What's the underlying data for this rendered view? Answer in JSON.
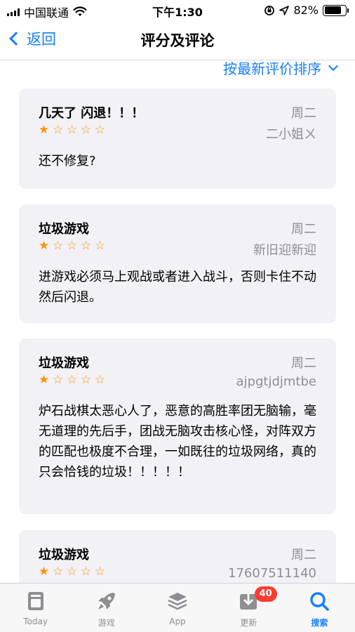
{
  "status_bar": {
    "carrier": "中国联通",
    "time": "下午1:30",
    "battery_percent_label": "82%",
    "battery_level": 0.82
  },
  "nav": {
    "back_label": "返回",
    "title": "评分及评论"
  },
  "sort": {
    "label": "按最新评价排序"
  },
  "reviews": [
    {
      "title": "几天了 闪退！！！",
      "date": "周二",
      "author": "二小姐ㄨ",
      "rating": 1,
      "stars": [
        "★",
        "☆",
        "☆",
        "☆",
        "☆"
      ],
      "body": "还不修复?"
    },
    {
      "title": "垃圾游戏",
      "date": "周二",
      "author": "新旧迎新迎",
      "rating": 1,
      "stars": [
        "★",
        "☆",
        "☆",
        "☆",
        "☆"
      ],
      "body": "进游戏必须马上观战或者进入战斗，否则卡住不动然后闪退。"
    },
    {
      "title": "垃圾游戏",
      "date": "周二",
      "author": "ajpgtjdjmtbe",
      "rating": 1,
      "stars": [
        "★",
        "☆",
        "☆",
        "☆",
        "☆"
      ],
      "body": "炉石战棋太恶心人了，恶意的高胜率团无脑输，毫无道理的先后手，团战无脑攻击核心怪，对阵双方的匹配也极度不合理，一如既往的垃圾网络，真的只会恰钱的垃圾！！！！！"
    },
    {
      "title": "垃圾游戏",
      "date": "周二",
      "author": "17607511140",
      "rating": 1,
      "stars": [
        "★",
        "☆",
        "☆",
        "☆",
        "☆"
      ],
      "body": ""
    }
  ],
  "tab_bar": {
    "tabs": [
      {
        "label": "Today",
        "icon": "today-icon",
        "active": false
      },
      {
        "label": "游戏",
        "icon": "rocket-icon",
        "active": false
      },
      {
        "label": "App",
        "icon": "app-stack-icon",
        "active": false
      },
      {
        "label": "更新",
        "icon": "download-icon",
        "active": false,
        "badge": "40"
      },
      {
        "label": "搜索",
        "icon": "search-icon",
        "active": true
      }
    ]
  },
  "colors": {
    "accent": "#147efb",
    "star": "#ff9500",
    "card_bg": "#f1f1f6",
    "badge": "#ff3b30",
    "secondary_text": "#8e8e93"
  }
}
